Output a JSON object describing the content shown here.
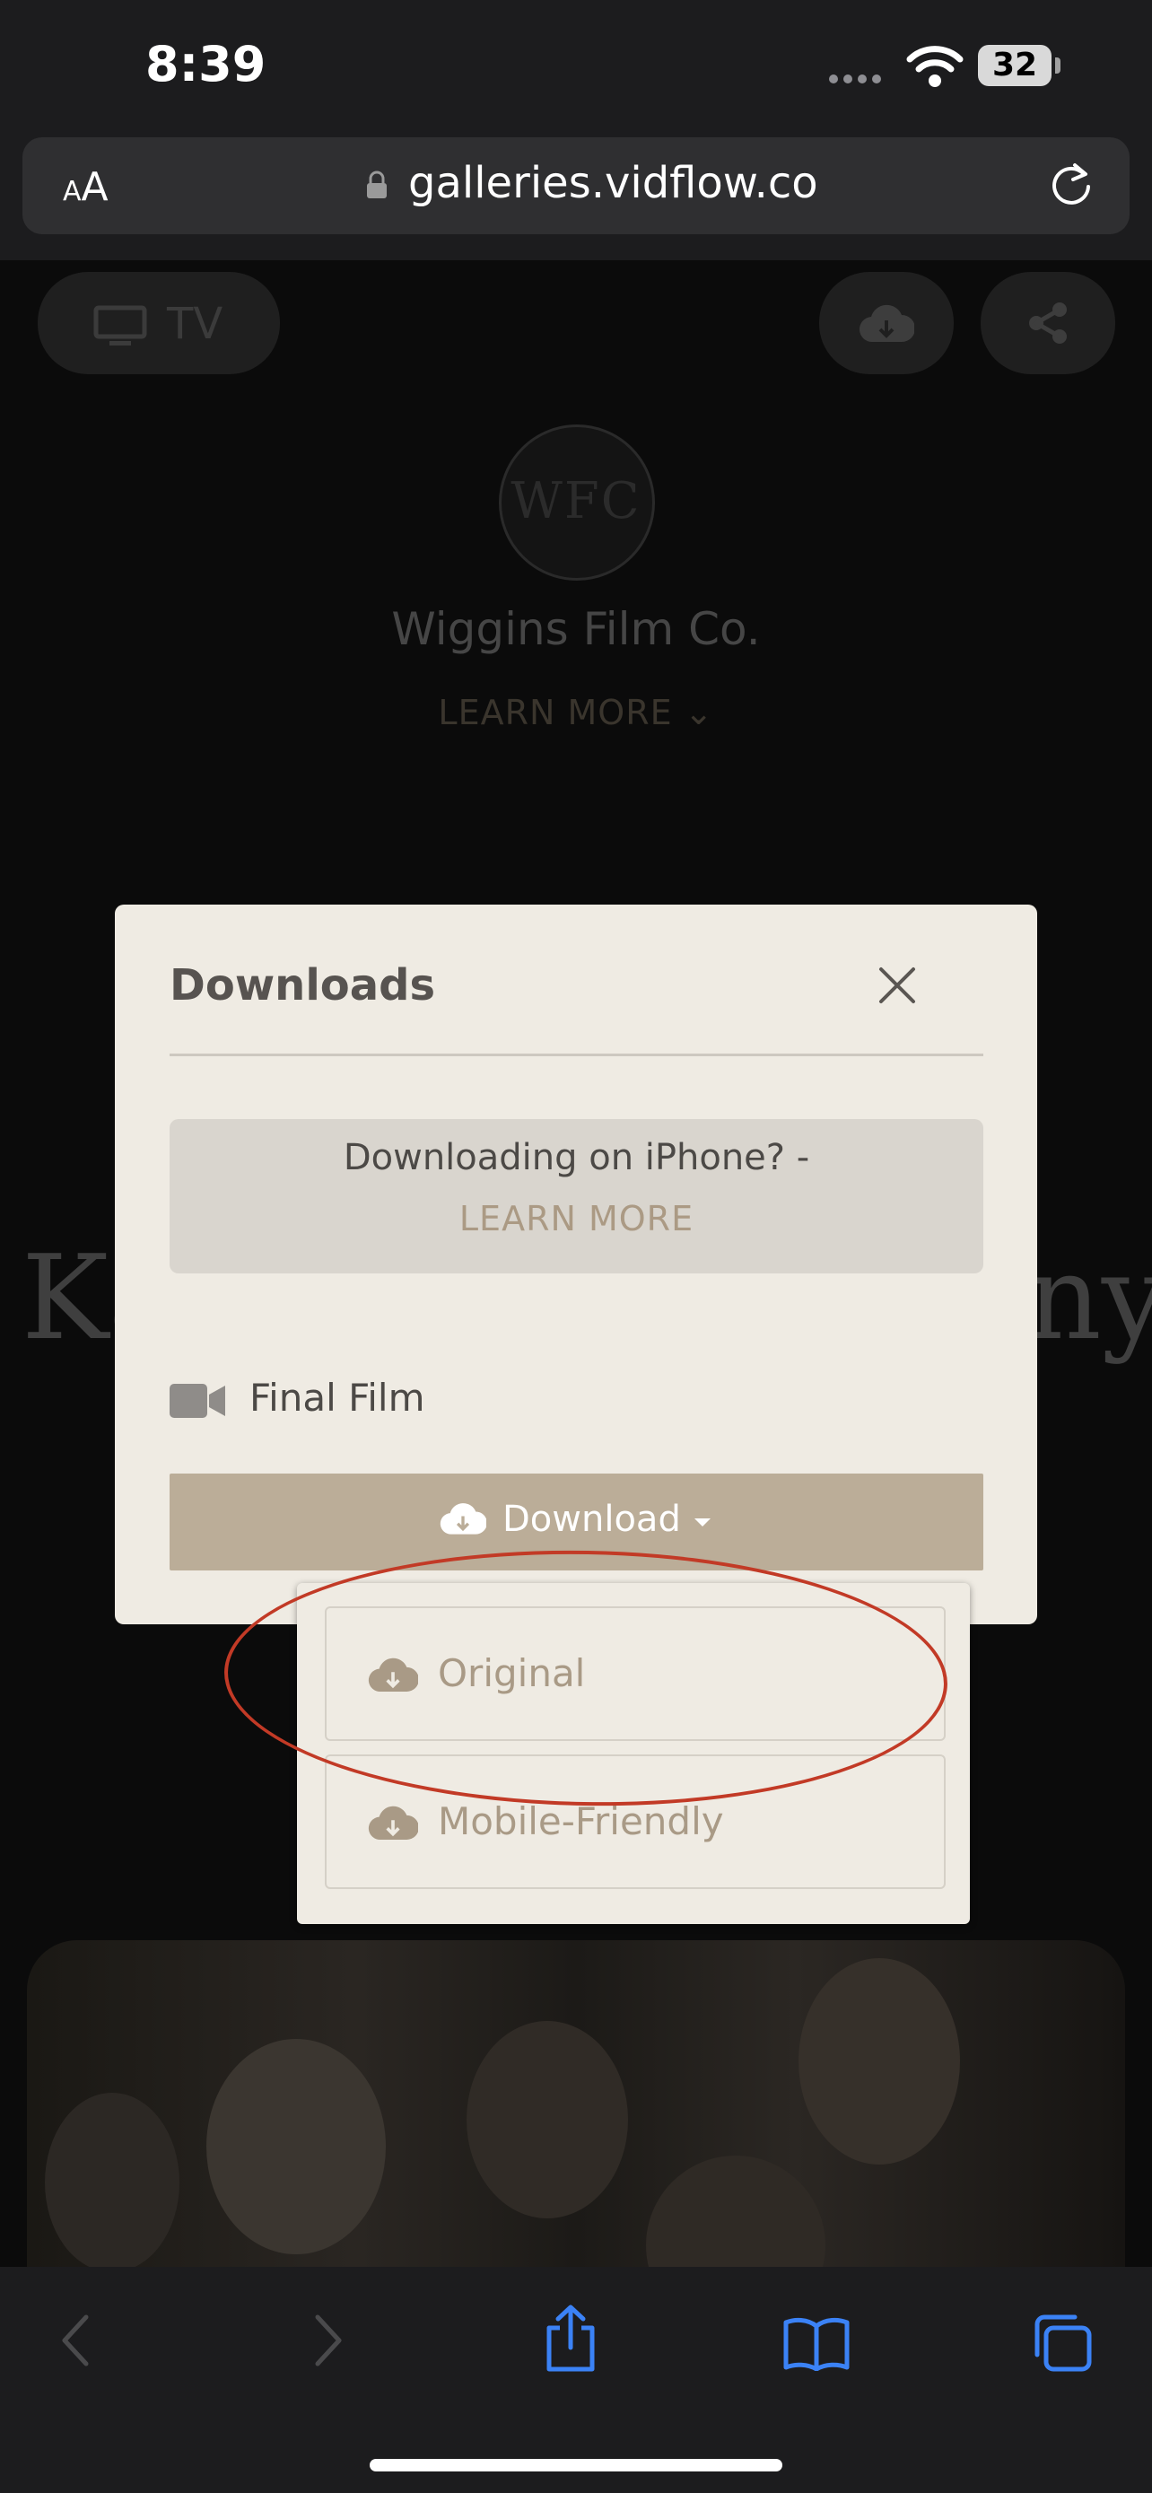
{
  "status_bar": {
    "time": "8:39",
    "battery": "32"
  },
  "browser": {
    "text_size_label": "AA",
    "url": "galleries.vidflow.co"
  },
  "page": {
    "tv_label": "TV",
    "logo_text": "WFC",
    "studio_name": "Wiggins Film Co.",
    "learn_more": "LEARN MORE",
    "bg_title_left": "Ka",
    "bg_title_right": "ny"
  },
  "modal": {
    "title": "Downloads",
    "info_line1": "Downloading on iPhone? -",
    "info_line2": "LEARN MORE",
    "film_label": "Final Film",
    "download_button": "Download",
    "options": [
      {
        "label": "Original"
      },
      {
        "label": "Mobile-Friendly"
      }
    ]
  },
  "colors": {
    "modal_bg": "#efebe3",
    "accent": "#bbad98",
    "annotation": "#c23a26",
    "ios_blue": "#3b82f6"
  }
}
